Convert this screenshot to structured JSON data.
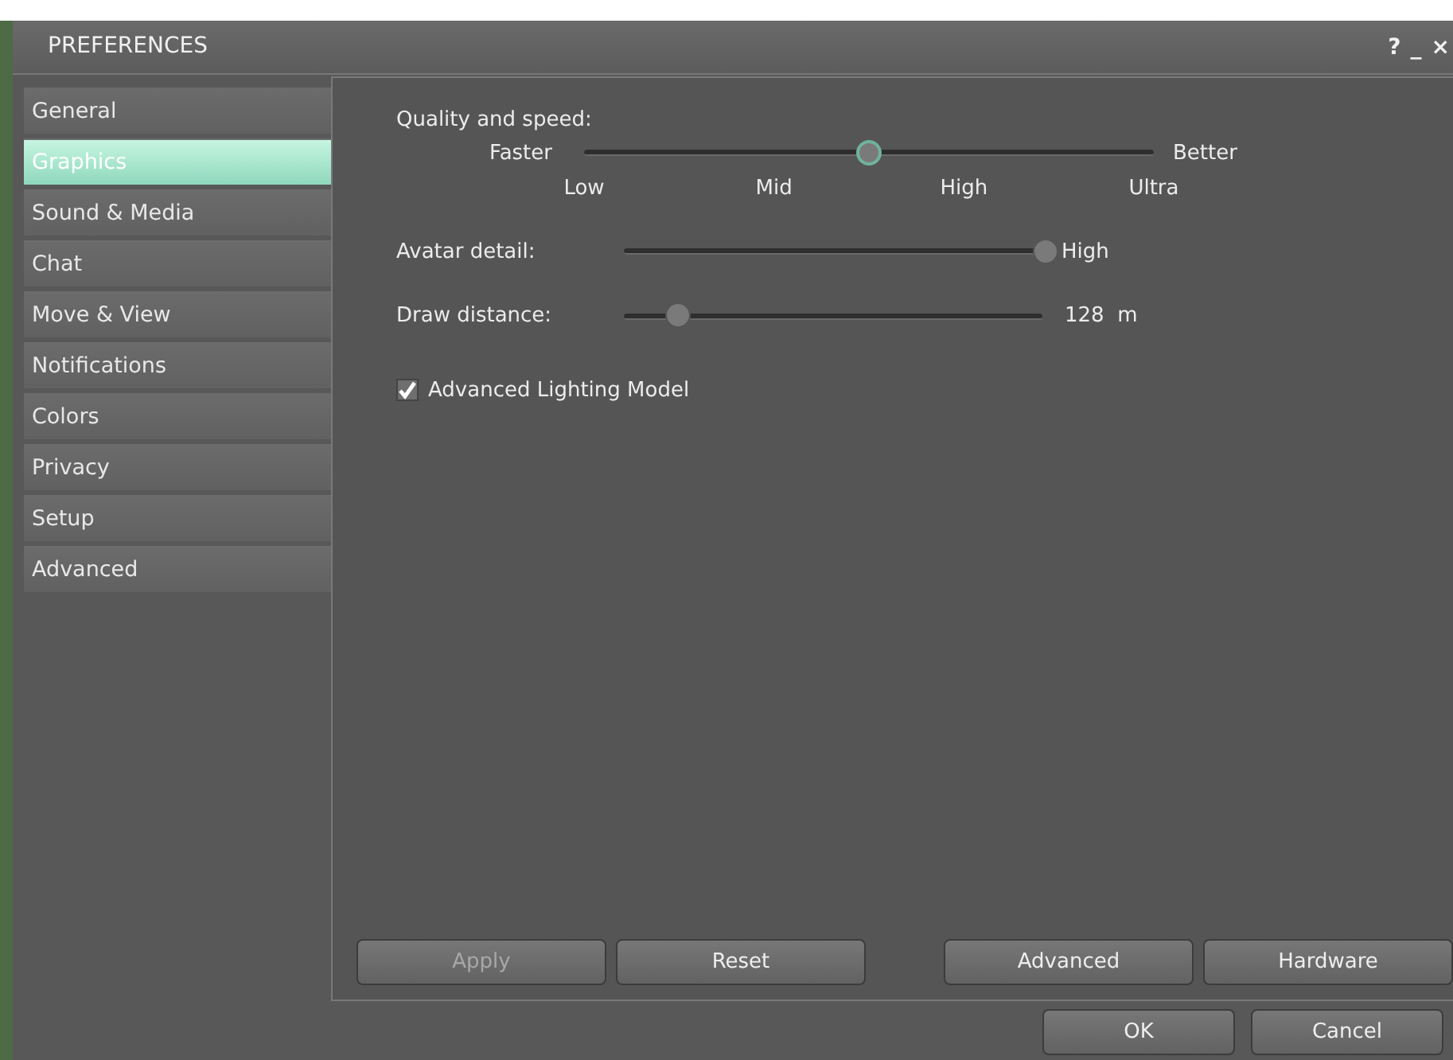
{
  "window": {
    "title": "PREFERENCES",
    "controls": [
      "?",
      "_",
      "×"
    ]
  },
  "sidebar": {
    "items": [
      {
        "label": "General",
        "selected": false
      },
      {
        "label": "Graphics",
        "selected": true
      },
      {
        "label": "Sound & Media",
        "selected": false
      },
      {
        "label": "Chat",
        "selected": false
      },
      {
        "label": "Move & View",
        "selected": false
      },
      {
        "label": "Notifications",
        "selected": false
      },
      {
        "label": "Colors",
        "selected": false
      },
      {
        "label": "Privacy",
        "selected": false
      },
      {
        "label": "Setup",
        "selected": false
      },
      {
        "label": "Advanced",
        "selected": false
      }
    ]
  },
  "quality": {
    "label": "Quality and speed:",
    "min_label": "Faster",
    "max_label": "Better",
    "level": 0.5,
    "ticks": [
      "Low",
      "Mid",
      "High",
      "Ultra"
    ]
  },
  "avatar_detail": {
    "label": "Avatar detail:",
    "level": 1,
    "reading": "High"
  },
  "draw_distance": {
    "label": "Draw distance:",
    "level": 0.13,
    "reading": "128  m"
  },
  "advanced_lighting": {
    "label": "Advanced Lighting Model",
    "checked": true
  },
  "panel_buttons": [
    {
      "label": "Apply",
      "disabled": true
    },
    {
      "label": "Reset",
      "disabled": false
    },
    {
      "label": "Advanced",
      "disabled": false
    },
    {
      "label": "Hardware",
      "disabled": false
    }
  ],
  "dialog_buttons": [
    {
      "label": "OK",
      "disabled": false
    },
    {
      "label": "Cancel",
      "disabled": false
    }
  ]
}
